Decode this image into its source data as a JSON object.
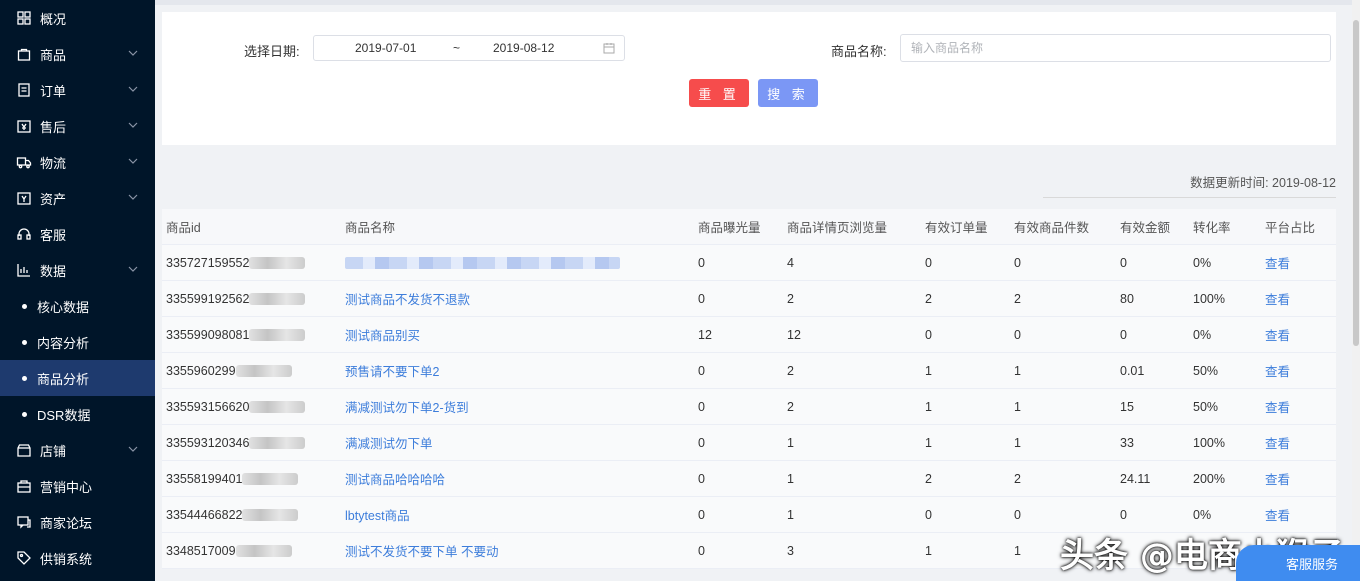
{
  "sidebar": {
    "items": [
      {
        "label": "概况",
        "icon": "grid-icon",
        "has_chevron": false
      },
      {
        "label": "商品",
        "icon": "bag-icon",
        "has_chevron": true
      },
      {
        "label": "订单",
        "icon": "order-icon",
        "has_chevron": true
      },
      {
        "label": "售后",
        "icon": "aftersale-icon",
        "has_chevron": true
      },
      {
        "label": "物流",
        "icon": "truck-icon",
        "has_chevron": true
      },
      {
        "label": "资产",
        "icon": "asset-icon",
        "has_chevron": true
      },
      {
        "label": "客服",
        "icon": "headset-icon",
        "has_chevron": false
      },
      {
        "label": "数据",
        "icon": "chart-icon",
        "has_chevron": true
      }
    ],
    "sub_items": [
      {
        "label": "核心数据",
        "active": false
      },
      {
        "label": "内容分析",
        "active": false
      },
      {
        "label": "商品分析",
        "active": true
      },
      {
        "label": "DSR数据",
        "active": false
      }
    ],
    "bottom_items": [
      {
        "label": "店铺",
        "icon": "shop-icon",
        "has_chevron": true
      },
      {
        "label": "营销中心",
        "icon": "marketing-icon",
        "has_chevron": false
      },
      {
        "label": "商家论坛",
        "icon": "forum-icon",
        "has_chevron": false
      },
      {
        "label": "供销系统",
        "icon": "tag-icon",
        "has_chevron": false
      }
    ]
  },
  "filter": {
    "date_label": "选择日期:",
    "date_start": "2019-07-01",
    "date_sep": "~",
    "date_end": "2019-08-12",
    "name_label": "商品名称:",
    "name_placeholder": "输入商品名称",
    "reset_label": "重 置",
    "search_label": "搜 索"
  },
  "update_time": "数据更新时间: 2019-08-12",
  "table": {
    "headers": [
      "商品id",
      "商品名称",
      "商品曝光量",
      "商品详情页浏览量",
      "有效订单量",
      "有效商品件数",
      "有效金额",
      "转化率",
      "平台占比"
    ],
    "rows": [
      {
        "id": "335727159552",
        "name": "",
        "exposure": "0",
        "views": "4",
        "orders": "0",
        "items": "0",
        "amount": "0",
        "conversion": "0%",
        "action": "查看"
      },
      {
        "id": "335599192562",
        "name": "测试商品不发货不退款",
        "exposure": "0",
        "views": "2",
        "orders": "2",
        "items": "2",
        "amount": "80",
        "conversion": "100%",
        "action": "查看"
      },
      {
        "id": "335599098081",
        "name": "测试商品别买",
        "exposure": "12",
        "views": "12",
        "orders": "0",
        "items": "0",
        "amount": "0",
        "conversion": "0%",
        "action": "查看"
      },
      {
        "id": "3355960299",
        "name": "预售请不要下单2",
        "exposure": "0",
        "views": "2",
        "orders": "1",
        "items": "1",
        "amount": "0.01",
        "conversion": "50%",
        "action": "查看"
      },
      {
        "id": "335593156620",
        "name": "满减测试勿下单2-货到",
        "exposure": "0",
        "views": "2",
        "orders": "1",
        "items": "1",
        "amount": "15",
        "conversion": "50%",
        "action": "查看"
      },
      {
        "id": "335593120346",
        "name": "满减测试勿下单",
        "exposure": "0",
        "views": "1",
        "orders": "1",
        "items": "1",
        "amount": "33",
        "conversion": "100%",
        "action": "查看"
      },
      {
        "id": "33558199401",
        "name": "测试商品哈哈哈哈",
        "exposure": "0",
        "views": "1",
        "orders": "2",
        "items": "2",
        "amount": "24.11",
        "conversion": "200%",
        "action": "查看"
      },
      {
        "id": "33544466822",
        "name": "lbtytest商品",
        "exposure": "0",
        "views": "1",
        "orders": "0",
        "items": "0",
        "amount": "0",
        "conversion": "0%",
        "action": "查看"
      },
      {
        "id": "3348517009",
        "name": "测试不发货不要下单 不要动",
        "exposure": "0",
        "views": "3",
        "orders": "1",
        "items": "1",
        "amount": "",
        "conversion": "",
        "action": ""
      }
    ]
  },
  "watermark": "头条 @电商小猴子",
  "service_label": "客服服务",
  "colors": {
    "sidebar_bg": "#001529",
    "active_bg": "#1e3a6e",
    "link": "#3d7ddb",
    "reset": "#f64c4c",
    "search": "#7b97f5"
  }
}
